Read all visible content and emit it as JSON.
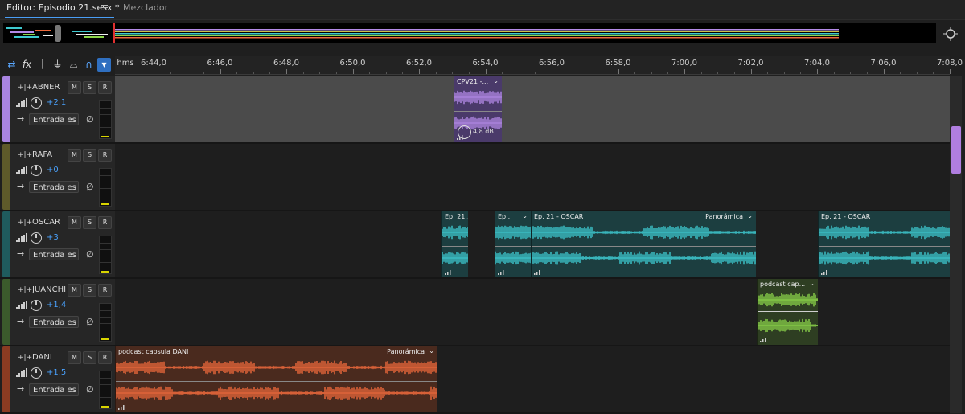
{
  "tabs": {
    "editor_label": "Editor: Episodio 21.sesx *",
    "mixer_label": "Mezclador"
  },
  "toolbar": {
    "tools": [
      "swap-icon",
      "fx-icon",
      "send-icon",
      "eq-icon",
      "magnet-icon",
      "marker-icon"
    ]
  },
  "ruler": {
    "unit": "hms",
    "labels": [
      "6:44,0",
      "6:46,0",
      "6:48,0",
      "6:50,0",
      "6:52,0",
      "6:54,0",
      "6:56,0",
      "6:58,0",
      "7:00,0",
      "7:02,0",
      "7:04,0",
      "7:06,0",
      "7:08,0"
    ]
  },
  "tracks": [
    {
      "name": "ABNER",
      "color": "#a884e0",
      "volume": "+2,1",
      "input": "Entrada es",
      "mute": "M",
      "solo": "S",
      "record": "R",
      "lane_bg": "#4b4b4b"
    },
    {
      "name": "RAFA",
      "color": "#5e5a2a",
      "volume": "+0",
      "input": "Entrada es",
      "mute": "M",
      "solo": "S",
      "record": "R",
      "lane_bg": "#1e1e1e"
    },
    {
      "name": "OSCAR",
      "color": "#1f5b5e",
      "volume": "+3",
      "input": "Entrada es",
      "mute": "M",
      "solo": "S",
      "record": "R",
      "lane_bg": "#1e1e1e"
    },
    {
      "name": "JUANCHI",
      "color": "#3b5a2c",
      "volume": "+1,4",
      "input": "Entrada es",
      "mute": "M",
      "solo": "S",
      "record": "R",
      "lane_bg": "#1e1e1e"
    },
    {
      "name": "DANI",
      "color": "#8a3b22",
      "volume": "+1,5",
      "input": "Entrada es",
      "mute": "M",
      "solo": "S",
      "record": "R",
      "lane_bg": "#1e1e1e"
    }
  ],
  "clips": {
    "abner": [
      {
        "title": "CPV21 -...",
        "gain": "4,8 dB",
        "pan": ""
      }
    ],
    "oscar": [
      {
        "title": "Ep. 21...",
        "pan": ""
      },
      {
        "title": "Ep...",
        "pan": ""
      },
      {
        "title": "Ep. 21 - OSCAR",
        "pan": "Panorámica"
      },
      {
        "title": "Ep. 21 - OSCAR",
        "pan": ""
      }
    ],
    "juanchi": [
      {
        "title": "podcast cap...",
        "pan": ""
      }
    ],
    "dani": [
      {
        "title": "podcast capsula DANI",
        "pan": "Panorámica"
      }
    ]
  },
  "colors": {
    "accent": "#4aa3ff",
    "abner_wave": "#b48ae8",
    "oscar_wave": "#3ec9d0",
    "juanchi_wave": "#8cd64a",
    "dani_wave": "#ef6a3c",
    "meter_peak": "#d8d400"
  }
}
